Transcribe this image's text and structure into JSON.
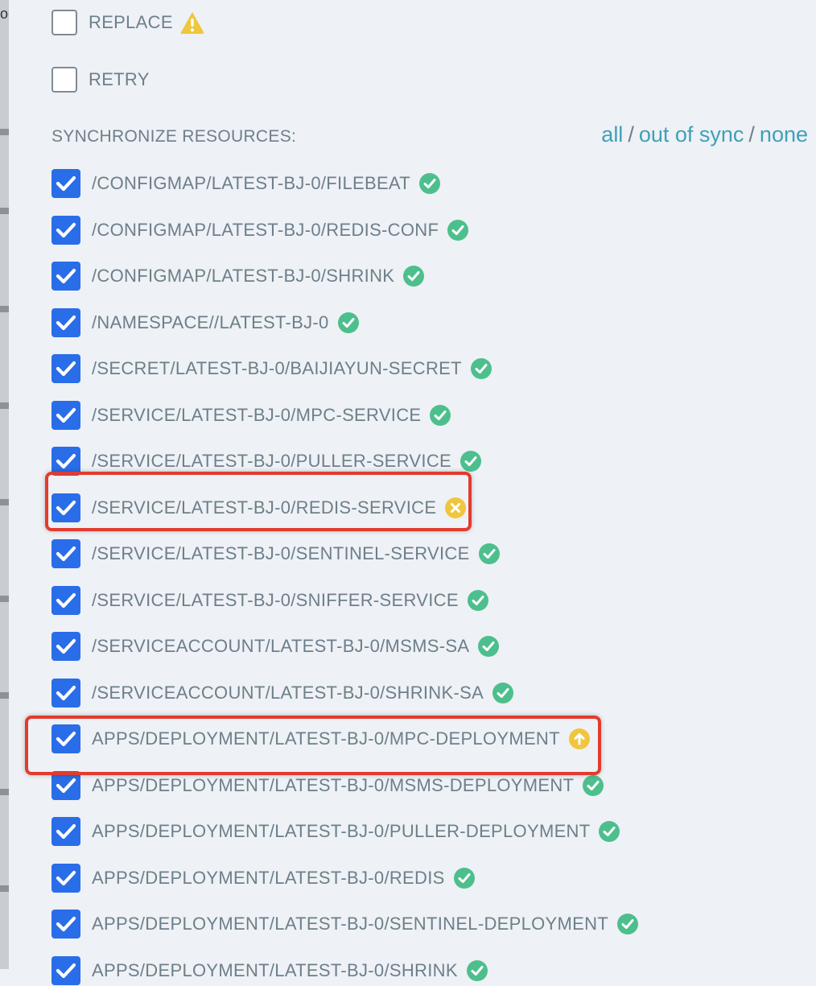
{
  "left_fragment": "oe",
  "options": {
    "replace_label": "REPLACE",
    "retry_label": "RETRY"
  },
  "sync": {
    "title": "SYNCHRONIZE RESOURCES:",
    "link_all": "all",
    "link_out_of_sync": "out of sync",
    "link_none": "none",
    "separator": "/"
  },
  "colors": {
    "checkbox": "#2a6de8",
    "synced": "#4dbf8d",
    "warning": "#f0c63e",
    "link": "#3fa0b9",
    "highlight": "#e23b2e"
  },
  "resources": [
    {
      "label": "/CONFIGMAP/LATEST-BJ-0/FILEBEAT",
      "status": "synced"
    },
    {
      "label": "/CONFIGMAP/LATEST-BJ-0/REDIS-CONF",
      "status": "synced"
    },
    {
      "label": "/CONFIGMAP/LATEST-BJ-0/SHRINK",
      "status": "synced"
    },
    {
      "label": "/NAMESPACE//LATEST-BJ-0",
      "status": "synced"
    },
    {
      "label": "/SECRET/LATEST-BJ-0/BAIJIAYUN-SECRET",
      "status": "synced"
    },
    {
      "label": "/SERVICE/LATEST-BJ-0/MPC-SERVICE",
      "status": "synced"
    },
    {
      "label": "/SERVICE/LATEST-BJ-0/PULLER-SERVICE",
      "status": "synced"
    },
    {
      "label": "/SERVICE/LATEST-BJ-0/REDIS-SERVICE",
      "status": "failed"
    },
    {
      "label": "/SERVICE/LATEST-BJ-0/SENTINEL-SERVICE",
      "status": "synced"
    },
    {
      "label": "/SERVICE/LATEST-BJ-0/SNIFFER-SERVICE",
      "status": "synced"
    },
    {
      "label": "/SERVICEACCOUNT/LATEST-BJ-0/MSMS-SA",
      "status": "synced"
    },
    {
      "label": "/SERVICEACCOUNT/LATEST-BJ-0/SHRINK-SA",
      "status": "synced"
    },
    {
      "label": "APPS/DEPLOYMENT/LATEST-BJ-0/MPC-DEPLOYMENT",
      "status": "out-of-sync"
    },
    {
      "label": "APPS/DEPLOYMENT/LATEST-BJ-0/MSMS-DEPLOYMENT",
      "status": "synced"
    },
    {
      "label": "APPS/DEPLOYMENT/LATEST-BJ-0/PULLER-DEPLOYMENT",
      "status": "synced"
    },
    {
      "label": "APPS/DEPLOYMENT/LATEST-BJ-0/REDIS",
      "status": "synced"
    },
    {
      "label": "APPS/DEPLOYMENT/LATEST-BJ-0/SENTINEL-DEPLOYMENT",
      "status": "synced"
    },
    {
      "label": "APPS/DEPLOYMENT/LATEST-BJ-0/SHRINK",
      "status": "synced"
    }
  ]
}
